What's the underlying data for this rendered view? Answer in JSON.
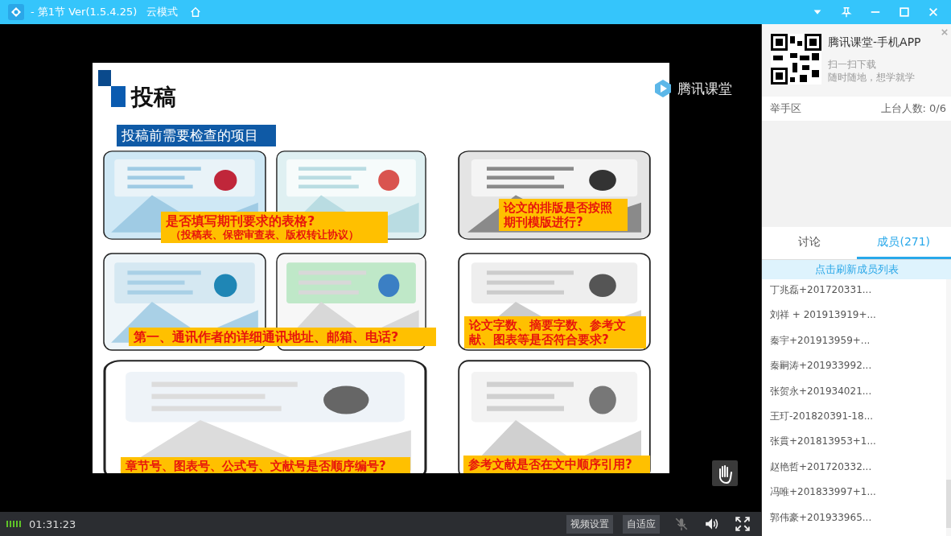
{
  "window": {
    "title": "- 第1节 Ver(1.5.4.25)",
    "mode": "云模式"
  },
  "slide": {
    "heading": "投稿",
    "logo_text": "腾讯课堂",
    "subtitle": "投稿前需要检查的项目",
    "captions": [
      {
        "lines": [
          "是否填写期刊要求的表格?",
          "（投稿表、保密审查表、版权转让协议）"
        ]
      },
      {
        "lines": [
          "论文的排版是否按照期刊模版进行?"
        ]
      },
      {
        "lines": [
          "第一、通讯作者的详细通讯地址、邮箱、电话?"
        ]
      },
      {
        "lines": [
          "论文字数、摘要字数、参考文献、图表等是否符合要求?"
        ]
      },
      {
        "lines": [
          "章节号、图表号、公式号、文献号是否顺序编号?"
        ]
      },
      {
        "lines": [
          "参考文献是否在文中顺序引用?"
        ]
      }
    ]
  },
  "playback": {
    "time": "01:31:23",
    "buttons": [
      "视频设置",
      "自适应"
    ]
  },
  "promo": {
    "title": "腾讯课堂-手机APP",
    "lines": [
      "扫一扫下载",
      "随时随地，想学就学"
    ]
  },
  "hand_raise": {
    "title": "举手区",
    "count": "上台人数: 0/6"
  },
  "tabs": [
    {
      "label": "讨论",
      "selected": false
    },
    {
      "label": "成员(271)",
      "selected": true
    }
  ],
  "refresh": "点击刷新成员列表",
  "members": [
    "丁兆磊+201720331...",
    "刘祥 + 201913919+...",
    "秦宇+201913959+...",
    "秦嗣涛+201933992...",
    "张贺永+201934021...",
    "王玎-201820391-18...",
    "张貫+201813953+1...",
    "赵艳哲+201720332...",
    "冯唯+201833997+1...",
    "郭伟豪+201933965..."
  ]
}
